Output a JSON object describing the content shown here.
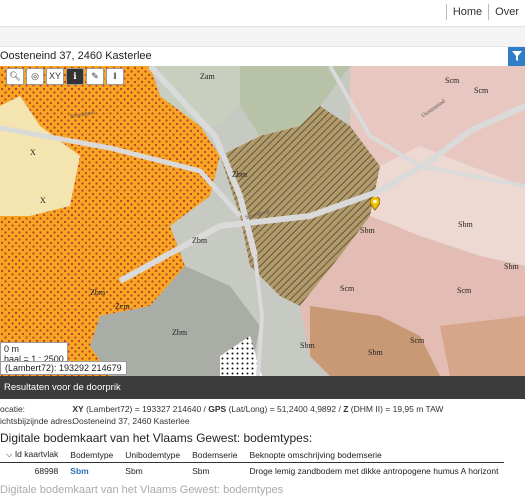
{
  "topnav": {
    "home": "Home",
    "overview": "Over"
  },
  "search": {
    "value": "Oosteneind 37, 2460 Kasterlee",
    "filter_icon": "funnel-icon"
  },
  "map": {
    "labels": [
      "Zam",
      "X",
      "X",
      "Zbm",
      "Zcm",
      "Zbm",
      "Sbm",
      "Sbm",
      "Scm",
      "Scm",
      "Sbm",
      "Sbm",
      "Scm",
      "Scm",
      "Zbm",
      "Zbm",
      "Scm",
      "Sbm"
    ],
    "road_labels": [
      "Sevenhout",
      "Oosteneind",
      "Sevenhout"
    ],
    "scale_unit": "0 m",
    "scale_text": "haal = 1 : 2500",
    "coord_text": "(Lambert72): 193292 214679"
  },
  "results": {
    "bar_title": "Resultaten voor de doorprik",
    "location_label": "ocatie:",
    "location_xy_label": "XY",
    "location_xy_sys": "(Lambert72) = 193327 214640 /",
    "location_gps_label": "GPS",
    "location_gps_sys": "(Lat/Long) = 51,2400 4,9892 /",
    "location_z_label": "Z",
    "location_z_sys": "(DHM II) = 19,95 m TAW",
    "address_label": "ichtsbijzijnde adres:",
    "address_value": "Oosteneind 37, 2460 Kasterlee",
    "section_title": "Digitale bodemkaart van het Vlaams Gewest: bodemtypes:",
    "columns": [
      "Id kaartvlak",
      "Bodemtype",
      "Unibodemtype",
      "Bodemserie",
      "Beknopte omschrijving bodemserie"
    ],
    "rows": [
      [
        "68998",
        "Sbm",
        "Sbm",
        "Sbm",
        "Droge lemig zandbodem met dikke antropogene humus A horizont"
      ]
    ],
    "next_title": "Digitale bodemkaart van het Vlaams Gewest: bodemtypes"
  }
}
